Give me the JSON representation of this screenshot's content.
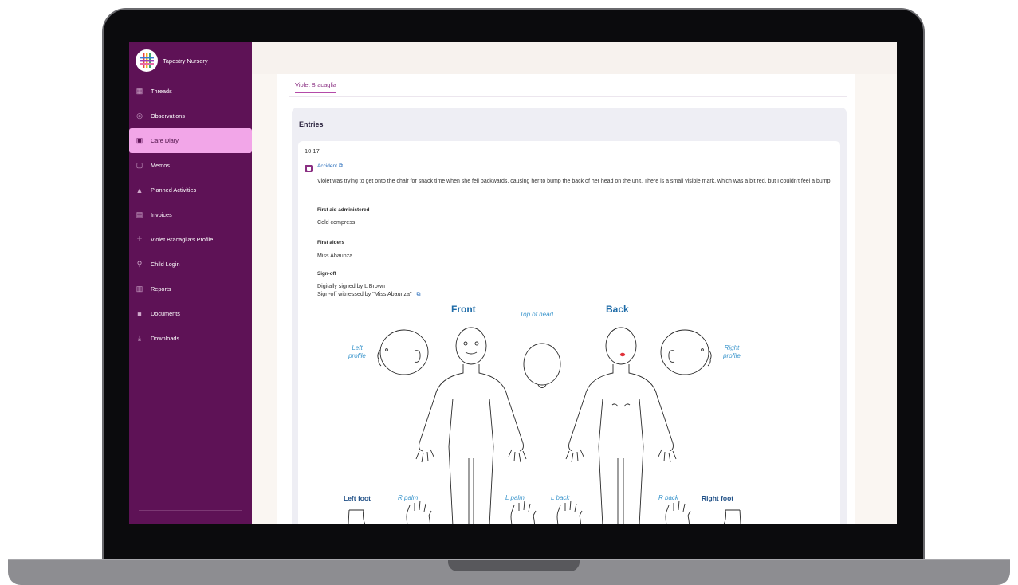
{
  "app": {
    "nursery_name": "Tapestry Nursery"
  },
  "sidebar": {
    "items": [
      {
        "label": "Threads",
        "icon": "threads-icon"
      },
      {
        "label": "Observations",
        "icon": "observations-icon"
      },
      {
        "label": "Care Diary",
        "icon": "care-diary-icon",
        "active": true
      },
      {
        "label": "Memos",
        "icon": "memos-icon"
      },
      {
        "label": "Planned Activities",
        "icon": "planned-activities-icon"
      },
      {
        "label": "Invoices",
        "icon": "invoices-icon"
      },
      {
        "label": "Violet Bracaglia's Profile",
        "icon": "profile-icon"
      },
      {
        "label": "Child Login",
        "icon": "child-login-icon"
      },
      {
        "label": "Reports",
        "icon": "reports-icon"
      },
      {
        "label": "Documents",
        "icon": "documents-icon"
      },
      {
        "label": "Downloads",
        "icon": "downloads-icon"
      }
    ]
  },
  "main": {
    "child_tab": "Violet Bracaglia",
    "entries_title": "Entries",
    "entry": {
      "time": "10:17",
      "type": "Accident",
      "description": "Violet was trying to get onto the chair for snack time when she fell backwards, causing her to bump the back of her head on the unit. There is a small visible mark, which was a bit red, but I couldn't feel a bump.",
      "first_aid_label": "First aid administered",
      "first_aid_value": "Cold compress",
      "first_aiders_label": "First aiders",
      "first_aiders_value": "Miss Abaunza",
      "signoff_label": "Sign-off",
      "signoff_line1": "Digitally signed by L Brown",
      "signoff_line2": "Sign-off witnessed by \"Miss Abaunza\""
    },
    "body_map": {
      "front": "Front",
      "back": "Back",
      "top_of_head": "Top of head",
      "left_profile_1": "Left",
      "left_profile_2": "profile",
      "right_profile_1": "Right",
      "right_profile_2": "profile",
      "left_foot": "Left foot",
      "right_foot": "Right foot",
      "r_palm": "R palm",
      "l_palm": "L palm",
      "l_back": "L back",
      "r_back": "R back"
    }
  },
  "colors": {
    "sidebar": "#5e1256",
    "active_item": "#f2a6e8",
    "link": "#2a6ebb",
    "map_title": "#1f6ca8",
    "injury_mark": "#e0323a"
  }
}
